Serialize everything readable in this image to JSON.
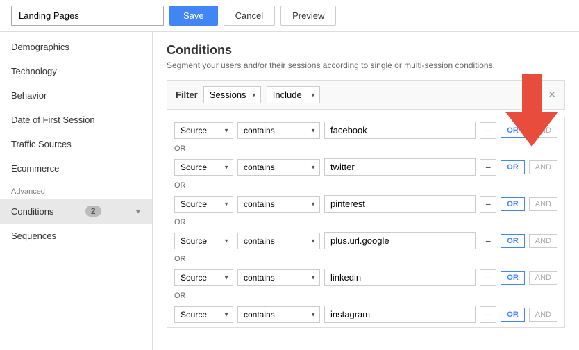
{
  "header": {
    "input_value": "Landing Pages",
    "save_label": "Save",
    "cancel_label": "Cancel",
    "preview_label": "Preview"
  },
  "sidebar": {
    "items": [
      {
        "id": "demographics",
        "label": "Demographics"
      },
      {
        "id": "technology",
        "label": "Technology"
      },
      {
        "id": "behavior",
        "label": "Behavior"
      },
      {
        "id": "date-of-first-session",
        "label": "Date of First Session"
      },
      {
        "id": "traffic-sources",
        "label": "Traffic Sources"
      },
      {
        "id": "ecommerce",
        "label": "Ecommerce"
      }
    ],
    "advanced_label": "Advanced",
    "conditions_label": "Conditions",
    "conditions_badge": "2",
    "sequences_label": "Sequences"
  },
  "content": {
    "title": "Conditions",
    "description": "Segment your users and/or their sessions according to single or multi-session conditions.",
    "filter": {
      "label": "Filter",
      "sessions_label": "Sessions",
      "include_label": "Include"
    },
    "rows": [
      {
        "id": 1,
        "dimension": "Source",
        "operator": "contains",
        "value": "facebook"
      },
      {
        "id": 2,
        "dimension": "Source",
        "operator": "contains",
        "value": "twitter"
      },
      {
        "id": 3,
        "dimension": "Source",
        "operator": "contains",
        "value": "pinterest"
      },
      {
        "id": 4,
        "dimension": "Source",
        "operator": "contains",
        "value": "plus.url.google"
      },
      {
        "id": 5,
        "dimension": "Source",
        "operator": "contains",
        "value": "linkedin"
      },
      {
        "id": 6,
        "dimension": "Source",
        "operator": "contains",
        "value": "instagram"
      }
    ],
    "or_text": "OR",
    "btn_or": "OR",
    "btn_and": "AND",
    "btn_minus": "−"
  }
}
